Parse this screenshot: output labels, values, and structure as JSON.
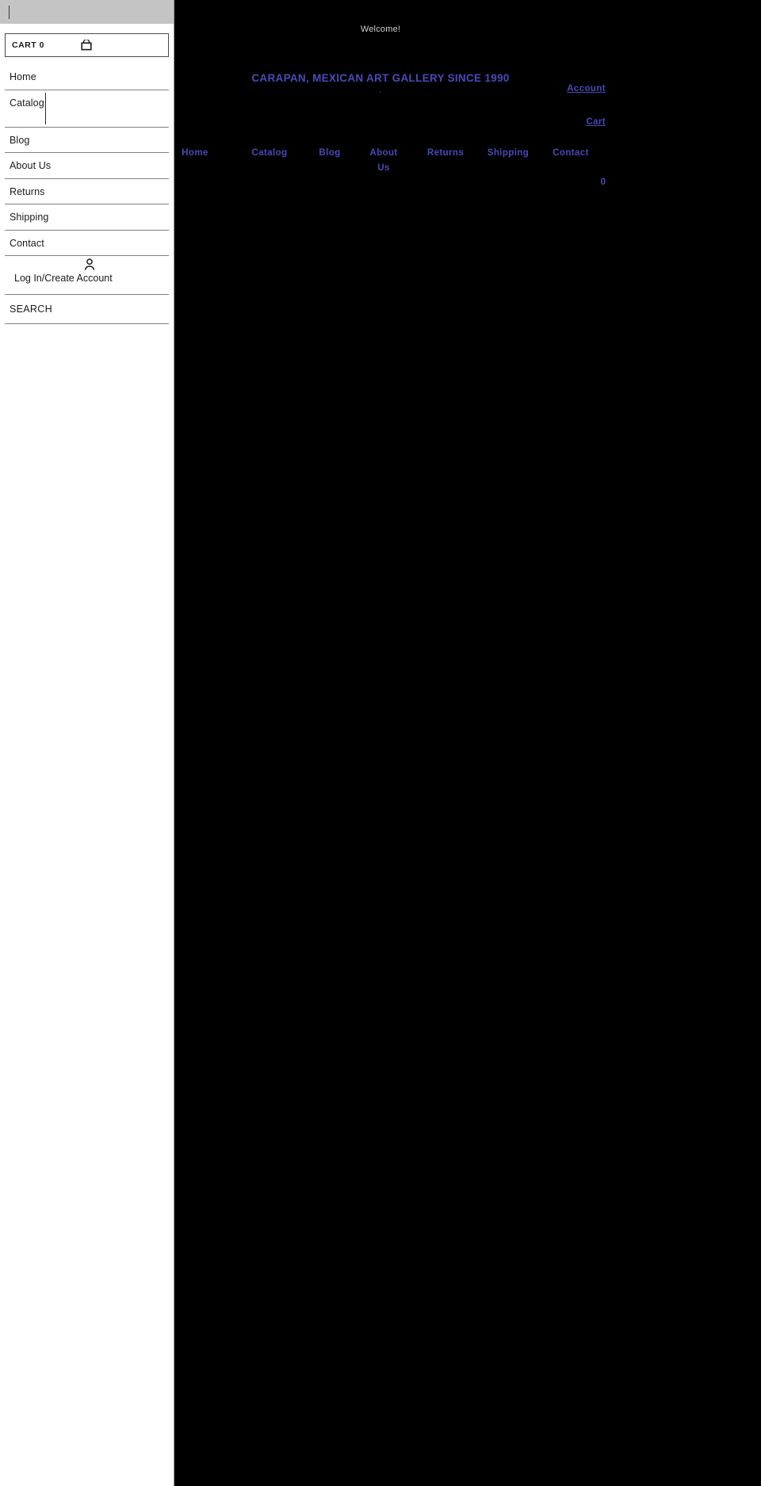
{
  "page": {
    "background_color": "#000000",
    "link_color": "#4b49b8",
    "welcome_text": "Welcome!",
    "site_title": "CARAPAN, MEXICAN ART GALLERY SINCE 1990",
    "title_dot": ".",
    "utility": {
      "account_label": "Account",
      "cart_label": "Cart",
      "cart_count": "0"
    },
    "nav": [
      {
        "label": "Home"
      },
      {
        "label": "Catalog"
      },
      {
        "label": "Blog"
      },
      {
        "label": "About Us"
      },
      {
        "label": "Returns"
      },
      {
        "label": "Shipping"
      },
      {
        "label": "Contact"
      }
    ]
  },
  "drawer": {
    "search": {
      "value": "",
      "placeholder": ""
    },
    "cart": {
      "label": "CART 0",
      "icon": "shopping-bag-icon"
    },
    "menu": [
      {
        "label": "Home",
        "has_submenu": false
      },
      {
        "label": "Catalog",
        "has_submenu": true
      },
      {
        "label": "Blog",
        "has_submenu": false
      },
      {
        "label": "About Us",
        "has_submenu": false
      },
      {
        "label": "Returns",
        "has_submenu": false
      },
      {
        "label": "Shipping",
        "has_submenu": false
      },
      {
        "label": "Contact",
        "has_submenu": false
      }
    ],
    "account": {
      "icon": "person-icon",
      "label": "Log In/Create Account"
    },
    "search_row": {
      "label": "SEARCH"
    }
  }
}
